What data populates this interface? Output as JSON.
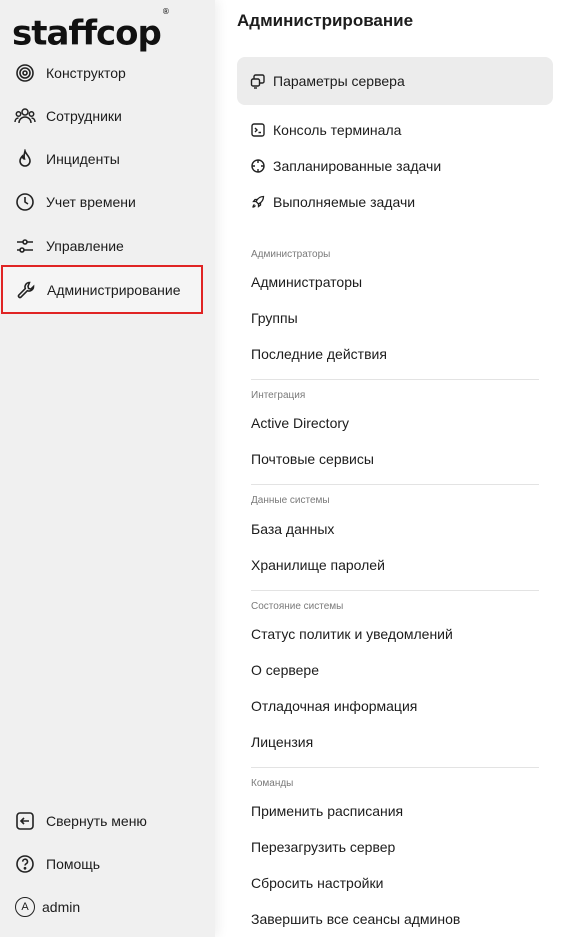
{
  "app": {
    "logo_text": "staffcop",
    "logo_mark": "®"
  },
  "sidebar": {
    "items": [
      {
        "label": "Конструктор",
        "icon": "target-icon"
      },
      {
        "label": "Сотрудники",
        "icon": "users-icon"
      },
      {
        "label": "Инциденты",
        "icon": "flame-icon"
      },
      {
        "label": "Учет времени",
        "icon": "clock-icon"
      },
      {
        "label": "Управление",
        "icon": "sliders-icon"
      },
      {
        "label": "Администрирование",
        "icon": "wrench-icon",
        "selected": true
      }
    ],
    "bottom": [
      {
        "label": "Свернуть меню",
        "icon": "collapse-icon"
      },
      {
        "label": "Помощь",
        "icon": "help-icon"
      },
      {
        "label": "admin",
        "avatar": "A"
      }
    ],
    "highlight_color": "#e02424"
  },
  "main": {
    "title": "Администрирование",
    "top_items": [
      {
        "label": "Параметры сервера",
        "icon": "server-icon",
        "active": true
      },
      {
        "label": "Консоль терминала",
        "icon": "terminal-icon"
      },
      {
        "label": "Запланированные задачи",
        "icon": "schedule-icon"
      },
      {
        "label": "Выполняемые задачи",
        "icon": "rocket-icon"
      }
    ],
    "sections": [
      {
        "heading": "Администраторы",
        "links": [
          "Администраторы",
          "Группы",
          "Последние действия"
        ]
      },
      {
        "heading": "Интеграция",
        "links": [
          "Active Directory",
          "Почтовые сервисы"
        ]
      },
      {
        "heading": "Данные системы",
        "links": [
          "База данных",
          "Хранилище паролей"
        ]
      },
      {
        "heading": "Состояние системы",
        "links": [
          "Статус политик и уведомлений",
          "О сервере",
          "Отладочная информация",
          "Лицензия"
        ]
      },
      {
        "heading": "Команды",
        "links": [
          "Применить расписания",
          "Перезагрузить сервер",
          "Сбросить настройки",
          "Завершить все сеансы админов"
        ]
      }
    ]
  }
}
